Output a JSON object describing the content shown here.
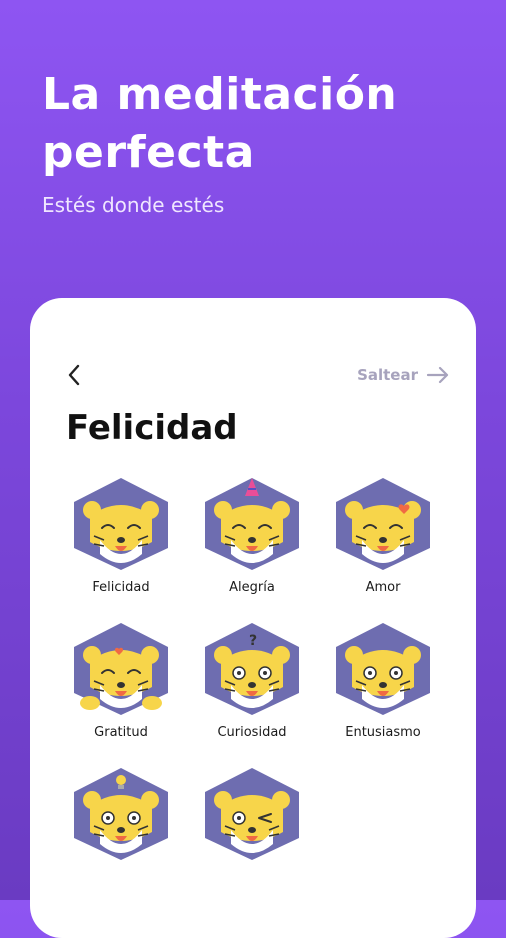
{
  "hero": {
    "title": "La meditación perfecta",
    "subtitle": "Estés donde estés"
  },
  "screen": {
    "back_icon": "chevron-left-icon",
    "skip_label": "Saltear",
    "skip_icon": "arrow-right-icon",
    "title": "Felicidad"
  },
  "emotions": [
    {
      "label": "Felicidad",
      "icon": "happy-tiger-icon"
    },
    {
      "label": "Alegría",
      "icon": "party-tiger-icon"
    },
    {
      "label": "Amor",
      "icon": "love-tiger-icon"
    },
    {
      "label": "Gratitud",
      "icon": "grateful-tiger-icon"
    },
    {
      "label": "Curiosidad",
      "icon": "curious-tiger-icon"
    },
    {
      "label": "Entusiasmo",
      "icon": "excited-tiger-icon"
    },
    {
      "label": "",
      "icon": "idea-tiger-icon"
    },
    {
      "label": "",
      "icon": "wink-tiger-icon"
    }
  ],
  "colors": {
    "background_top": "#8e55f2",
    "background_bottom": "#6a3bc2",
    "hexagon": "#6e6db0",
    "tiger": "#f7d54a",
    "skip": "#a7a3bd"
  }
}
